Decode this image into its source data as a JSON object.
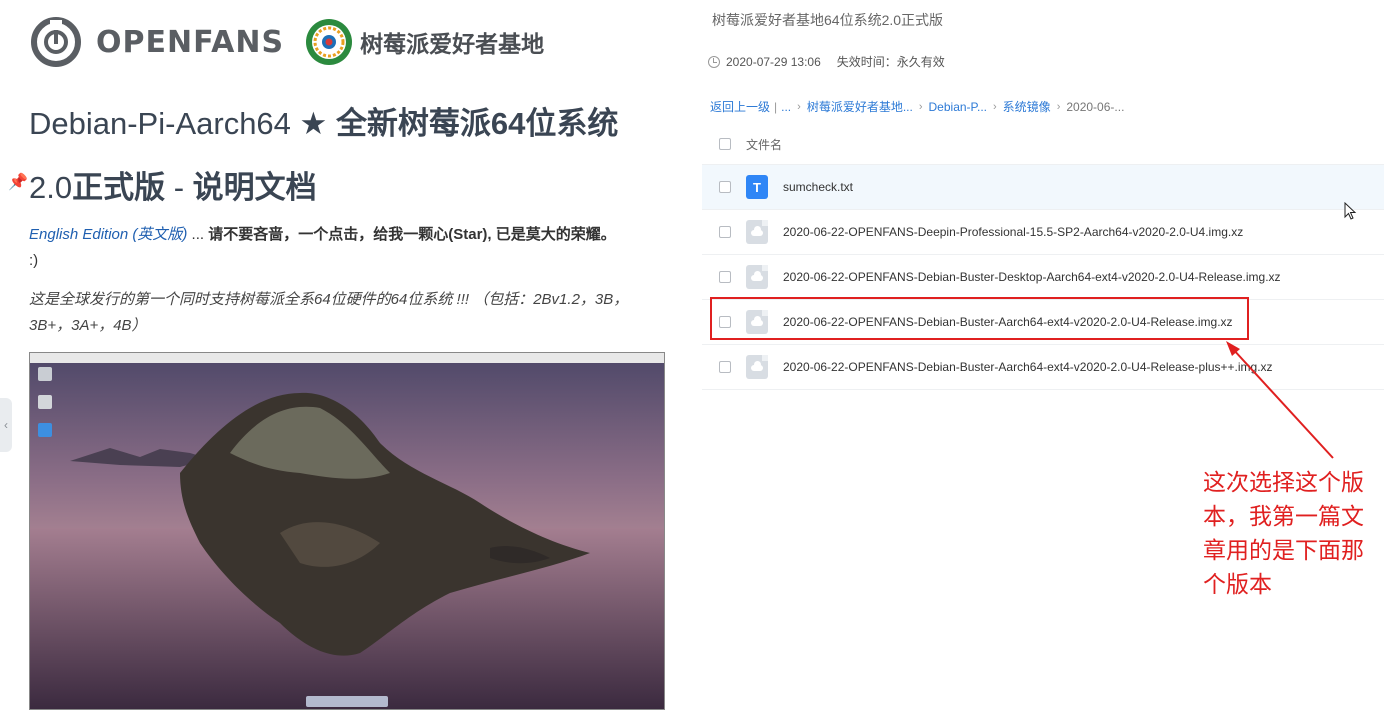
{
  "article": {
    "brand": "OPENFANS",
    "partner": "树莓派爱好者基地",
    "title_part1": "Debian-Pi-Aarch64 ★ ",
    "title_part2": "全新树莓派64位系统",
    "title_line2_a": "2.0",
    "title_line2_b": "正式版",
    "title_line2_c": " - ",
    "title_line2_d": "说明文档",
    "english_link": "English Edition (英文版)",
    "intro_dots": " ... ",
    "intro_text": "请不要吝啬，一个点击，给我一颗心(Star), 已是莫大的荣耀。",
    "intro_smile": ":)",
    "support_text": "这是全球发行的第一个同时支持树莓派全系64位硬件的64位系统 !!! （包括：2Bv1.2，3B，3B+，3A+，4B）"
  },
  "share": {
    "title": "树莓派爱好者基地64位系统2.0正式版",
    "date": "2020-07-29 13:06",
    "expire": "失效时间：永久有效",
    "breadcrumb": {
      "back": "返回上一级",
      "sep_bar": "|",
      "ellipsis": "...",
      "items": [
        "树莓派爱好者基地...",
        "Debian-P...",
        "系统镜像"
      ],
      "current": "2020-06-..."
    },
    "column_filename": "文件名",
    "files": [
      {
        "name": "sumcheck.txt",
        "type": "txt",
        "icon_letter": "T"
      },
      {
        "name": "2020-06-22-OPENFANS-Deepin-Professional-15.5-SP2-Aarch64-v2020-2.0-U4.img.xz",
        "type": "img"
      },
      {
        "name": "2020-06-22-OPENFANS-Debian-Buster-Desktop-Aarch64-ext4-v2020-2.0-U4-Release.img.xz",
        "type": "img"
      },
      {
        "name": "2020-06-22-OPENFANS-Debian-Buster-Aarch64-ext4-v2020-2.0-U4-Release.img.xz",
        "type": "img"
      },
      {
        "name": "2020-06-22-OPENFANS-Debian-Buster-Aarch64-ext4-v2020-2.0-U4-Release-plus++.img.xz",
        "type": "img"
      }
    ]
  },
  "annotation": {
    "note": "这次选择这个版本，我第一篇文章用的是下面那个版本",
    "color": "#e02020"
  },
  "colors": {
    "link": "#2d7ad6",
    "title": "#3a4553",
    "txt_icon": "#2f86f6"
  }
}
